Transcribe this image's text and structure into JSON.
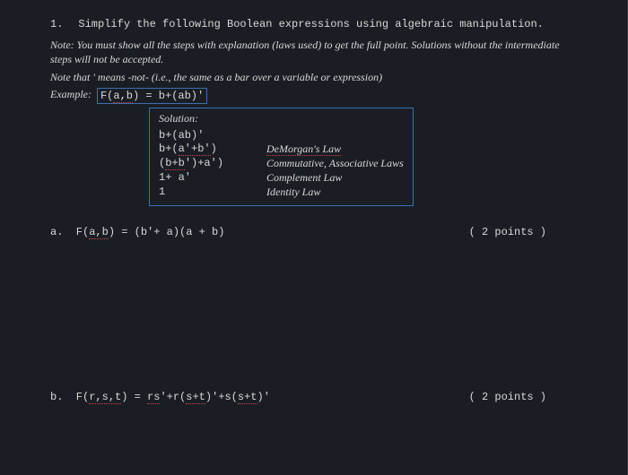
{
  "question": {
    "number": "1.",
    "title": "Simplify the following Boolean expressions using algebraic manipulation.",
    "note1": "Note: You must show all the steps with explanation (laws used) to get the full point. Solutions without the intermediate steps will not be accepted.",
    "note2": "Note that ' means -not- (i.e., the same as a bar over a variable or expression)"
  },
  "example": {
    "label": "Example:",
    "func": "F(a,b) = b+(ab)'",
    "solution_label": "Solution:",
    "steps": [
      {
        "expr": "b+(ab)'",
        "law": ""
      },
      {
        "expr": "b+(a'+b')",
        "law": "DeMorgan's Law",
        "expr_ul": true,
        "law_ul": true
      },
      {
        "expr": "(b+b')+a')",
        "law": "Commutative, Associative Laws",
        "prefix_ul": true
      },
      {
        "expr": "1+ a'",
        "law": "Complement Law"
      },
      {
        "expr": "1",
        "law": "Identity Law"
      }
    ]
  },
  "problems": {
    "a": {
      "label": "a.",
      "expr": "F(a,b) = (b'+ a)(a + b)",
      "points": "( 2 points )"
    },
    "b": {
      "label": "b.",
      "expr": "F(r,s,t) = rs'+r(s+t)'+s(s+t)'",
      "points": "( 2 points )"
    }
  }
}
